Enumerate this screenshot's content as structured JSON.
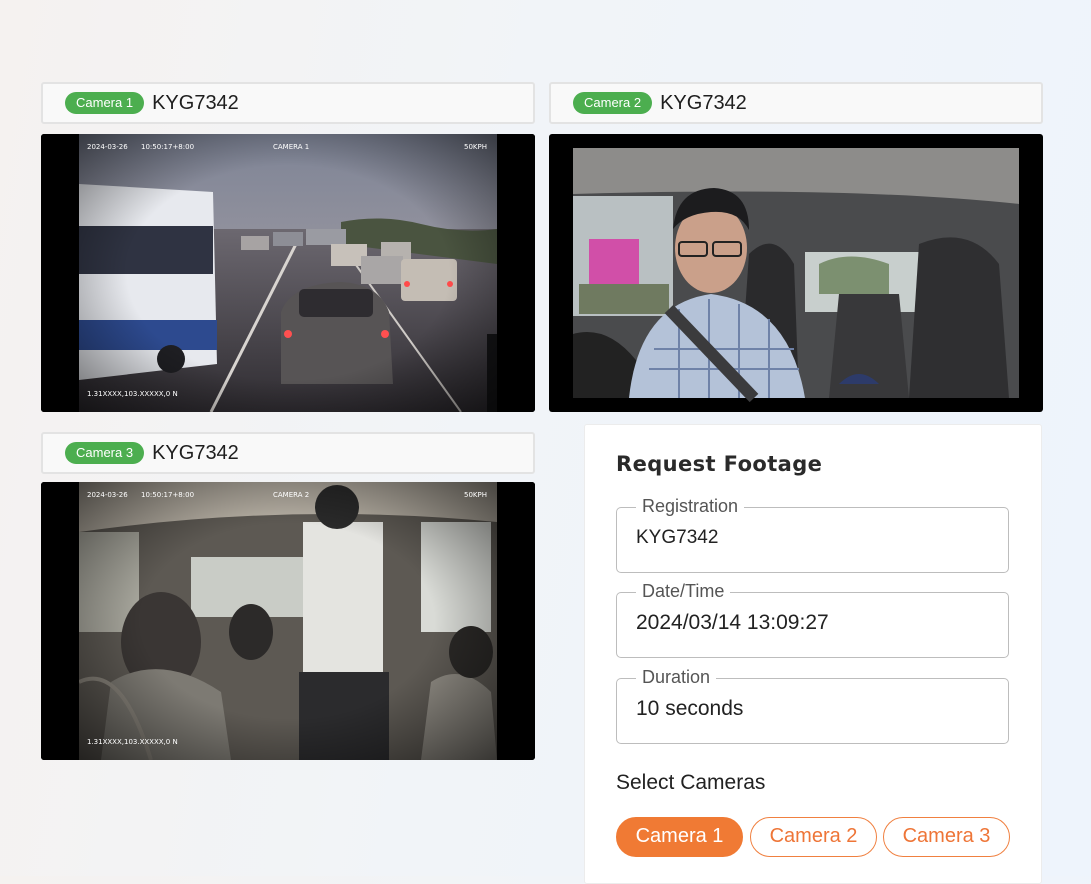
{
  "cameras": [
    {
      "badge": "Camera 1",
      "plate": "KYG7342",
      "osd": {
        "date": "2024-03-26",
        "time": "10:50:17+8:00",
        "name": "CAMERA 1",
        "speed": "50KPH",
        "gps": "1.31XXXX,103.XXXXX,0 N"
      }
    },
    {
      "badge": "Camera 2",
      "plate": "KYG7342"
    },
    {
      "badge": "Camera 3",
      "plate": "KYG7342",
      "osd": {
        "date": "2024-03-26",
        "time": "10:50:17+8:00",
        "name": "CAMERA 2",
        "speed": "50KPH",
        "gps": "1.31XXXX,103.XXXXX,0 N"
      }
    }
  ],
  "request_form": {
    "title": "Request Footage",
    "fields": [
      {
        "label": "Registration",
        "value": "KYG7342"
      },
      {
        "label": "Date/Time",
        "value": "2024/03/14 13:09:27"
      },
      {
        "label": "Duration",
        "value": "10 seconds"
      }
    ],
    "select_label": "Select Cameras",
    "camera_options": [
      {
        "label": "Camera 1",
        "selected": true
      },
      {
        "label": "Camera 2",
        "selected": false
      },
      {
        "label": "Camera 3",
        "selected": false
      }
    ]
  },
  "colors": {
    "badge_green": "#4cae4f",
    "accent_orange": "#f07a34"
  }
}
